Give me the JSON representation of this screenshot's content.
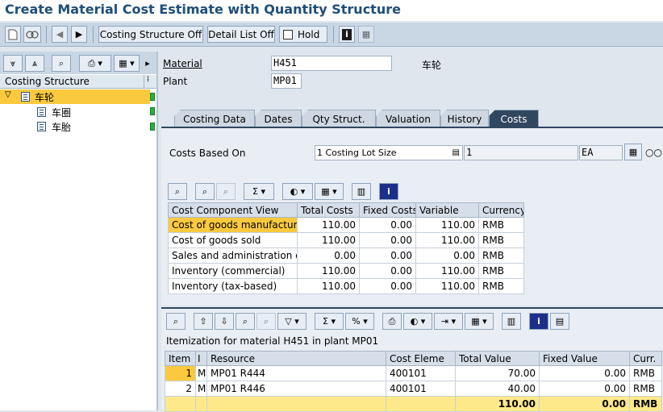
{
  "window": {
    "title": "Create Material Cost Estimate with Quantity Structure"
  },
  "toolbar": {
    "costing_structure_off": "Costing Structure Off",
    "detail_list_off": "Detail List Off",
    "hold": "Hold"
  },
  "left_panel": {
    "header": "Costing Structure",
    "tree": [
      {
        "label": "车轮",
        "level": 0,
        "selected": true
      },
      {
        "label": "车圈",
        "level": 1,
        "selected": false
      },
      {
        "label": "车胎",
        "level": 1,
        "selected": false
      }
    ]
  },
  "header_fields": {
    "material_label": "Material",
    "material_value": "H451",
    "material_desc": "车轮",
    "plant_label": "Plant",
    "plant_value": "MP01"
  },
  "tabs": [
    {
      "label": "Costing Data",
      "active": false
    },
    {
      "label": "Dates",
      "active": false
    },
    {
      "label": "Qty Struct.",
      "active": false
    },
    {
      "label": "Valuation",
      "active": false
    },
    {
      "label": "History",
      "active": false
    },
    {
      "label": "Costs",
      "active": true
    }
  ],
  "costs_tab": {
    "based_on_label": "Costs Based On",
    "based_on_value": "1 Costing Lot Size",
    "quantity": "1",
    "unit": "EA",
    "grid": {
      "columns": [
        "Cost Component View",
        "Total Costs",
        "Fixed Costs",
        "Variable",
        "Currency"
      ],
      "rows": [
        {
          "view": "Cost of goods manufactured",
          "total": "110.00",
          "fixed": "0.00",
          "variable": "110.00",
          "currency": "RMB"
        },
        {
          "view": "Cost of goods sold",
          "total": "110.00",
          "fixed": "0.00",
          "variable": "110.00",
          "currency": "RMB"
        },
        {
          "view": "Sales and administration cost",
          "total": "0.00",
          "fixed": "0.00",
          "variable": "0.00",
          "currency": "RMB"
        },
        {
          "view": "Inventory (commercial)",
          "total": "110.00",
          "fixed": "0.00",
          "variable": "110.00",
          "currency": "RMB"
        },
        {
          "view": "Inventory (tax-based)",
          "total": "110.00",
          "fixed": "0.00",
          "variable": "110.00",
          "currency": "RMB"
        }
      ]
    }
  },
  "itemization": {
    "title": "Itemization for material H451 in plant MP01",
    "columns": [
      "Item",
      "I",
      "Resource",
      "Cost Eleme",
      "Total Value",
      "Fixed Value",
      "Curr."
    ],
    "rows": [
      {
        "item": "1",
        "i": "M",
        "resource": "MP01 R444",
        "cost_element": "400101",
        "total": "70.00",
        "fixed": "0.00",
        "currency": "RMB"
      },
      {
        "item": "2",
        "i": "M",
        "resource": "MP01 R446",
        "cost_element": "400101",
        "total": "40.00",
        "fixed": "0.00",
        "currency": "RMB"
      }
    ],
    "totals": {
      "total": "110.00",
      "fixed": "0.00",
      "currency": "RMB"
    }
  },
  "colors": {
    "title": "#1e4e79",
    "selection": "#fbc93d",
    "active_tab": "#31475f",
    "total_row": "#fde98a"
  }
}
